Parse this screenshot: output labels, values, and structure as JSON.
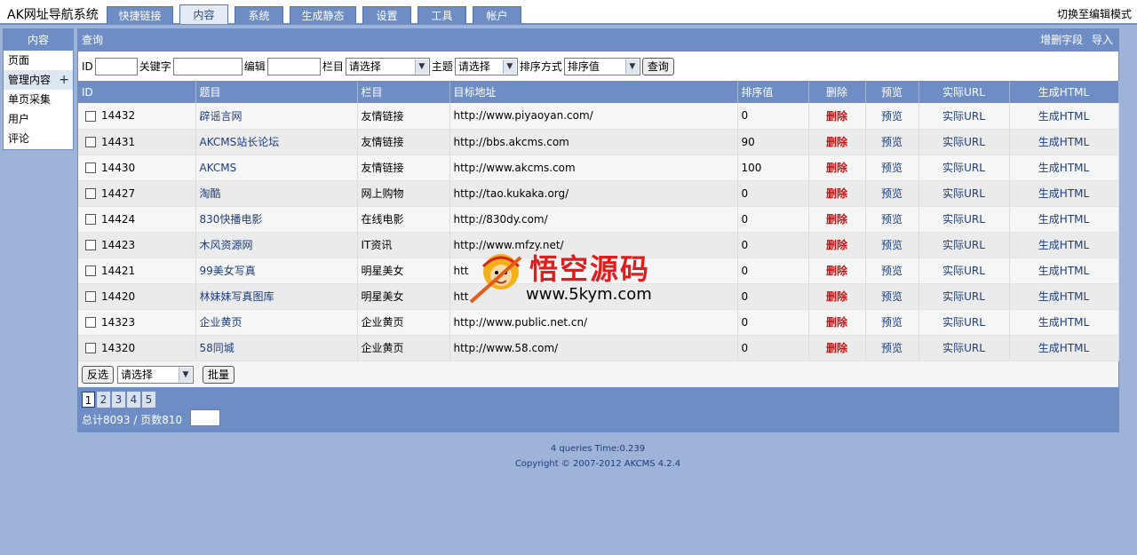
{
  "app": {
    "title": "AK网址导航系统",
    "edit_mode": "切换至编辑模式"
  },
  "top_tabs": [
    {
      "label": "快捷链接"
    },
    {
      "label": "内容"
    },
    {
      "label": "系统"
    },
    {
      "label": "生成静态"
    },
    {
      "label": "设置"
    },
    {
      "label": "工具"
    },
    {
      "label": "帐户"
    }
  ],
  "sidebar": {
    "title": "内容",
    "items": [
      {
        "label": "页面"
      },
      {
        "label": "管理内容",
        "plus": "+"
      },
      {
        "label": "单页采集"
      },
      {
        "label": "用户"
      },
      {
        "label": "评论"
      }
    ]
  },
  "main": {
    "title": "查询",
    "actions": [
      "增删字段",
      "导入"
    ]
  },
  "query": {
    "id_label": "ID",
    "keyword_label": "关键字",
    "editor_label": "编辑",
    "column_label": "栏目",
    "column_select": "请选择",
    "topic_label": "主题",
    "topic_select": "请选择",
    "sort_label": "排序方式",
    "sort_select": "排序值",
    "search_button": "查询"
  },
  "table": {
    "headers": [
      "ID",
      "题目",
      "栏目",
      "目标地址",
      "排序值",
      "删除",
      "预览",
      "实际URL",
      "生成HTML"
    ],
    "rows": [
      {
        "id": "14432",
        "title": "辟谣言网",
        "column": "友情链接",
        "url": "http://www.piyaoyan.com/",
        "sort": "0"
      },
      {
        "id": "14431",
        "title": "AKCMS站长论坛",
        "column": "友情链接",
        "url": "http://bbs.akcms.com",
        "sort": "90"
      },
      {
        "id": "14430",
        "title": "AKCMS",
        "column": "友情链接",
        "url": "http://www.akcms.com",
        "sort": "100"
      },
      {
        "id": "14427",
        "title": "淘酷",
        "column": "网上购物",
        "url": "http://tao.kukaka.org/",
        "sort": "0"
      },
      {
        "id": "14424",
        "title": "830快播电影",
        "column": "在线电影",
        "url": "http://830dy.com/",
        "sort": "0"
      },
      {
        "id": "14423",
        "title": "木风资源网",
        "column": "IT资讯",
        "url": "http://www.mfzy.net/",
        "sort": "0"
      },
      {
        "id": "14421",
        "title": "99美女写真",
        "column": "明星美女",
        "url": "htt",
        "sort": "0"
      },
      {
        "id": "14420",
        "title": "林妹妹写真图库",
        "column": "明星美女",
        "url": "htt",
        "sort": "0"
      },
      {
        "id": "14323",
        "title": "企业黄页",
        "column": "企业黄页",
        "url": "http://www.public.net.cn/",
        "sort": "0"
      },
      {
        "id": "14320",
        "title": "58同城",
        "column": "企业黄页",
        "url": "http://www.58.com/",
        "sort": "0"
      }
    ],
    "delete_label": "删除",
    "preview_label": "预览",
    "realurl_label": "实际URL",
    "html_label": "生成HTML"
  },
  "bulk": {
    "invert_button": "反选",
    "select": "请选择",
    "batch_button": "批量"
  },
  "pager": {
    "pages": [
      "1",
      "2",
      "3",
      "4",
      "5"
    ],
    "current": "1",
    "total_text": "总计8093 / 页数810"
  },
  "footer": {
    "queries": "4 queries Time:0.239",
    "copyright": "Copyright © 2007-2012 AKCMS 4.2.4"
  },
  "watermark": {
    "title": "悟空源码",
    "url": "www.5kym.com"
  }
}
